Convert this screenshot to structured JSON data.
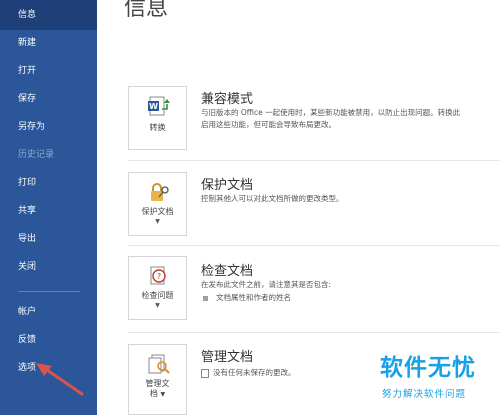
{
  "sidebar": {
    "items": [
      {
        "label": "信息"
      },
      {
        "label": "新建"
      },
      {
        "label": "打开"
      },
      {
        "label": "保存"
      },
      {
        "label": "另存为"
      },
      {
        "label": "历史记录"
      },
      {
        "label": "打印"
      },
      {
        "label": "共享"
      },
      {
        "label": "导出"
      },
      {
        "label": "关闭"
      },
      {
        "label": "帐户"
      },
      {
        "label": "反馈"
      },
      {
        "label": "选项"
      }
    ]
  },
  "main": {
    "title": "信息",
    "cards": [
      {
        "button_label": "转换",
        "title": "兼容模式",
        "desc_line1": "与旧版本的 Office 一起使用时，某些新功能被禁用，以防止出现问题。转换此",
        "desc_line2": "启用这些功能，但可能会导致布局更改。"
      },
      {
        "button_label": "保护文档",
        "title": "保护文档",
        "desc_line1": "控制其他人可以对此文档所做的更改类型。"
      },
      {
        "button_label": "检查问题",
        "title": "检查文档",
        "desc_line1": "在发布此文件之前，请注意其是否包含:",
        "bullet": "文档属性和作者的姓名"
      },
      {
        "button_label": "管理文档",
        "button_label_line1": "管理文",
        "button_label_line2": "档",
        "title": "管理文档",
        "desc_line1": "没有任何未保存的更改。"
      }
    ]
  },
  "watermark": {
    "main": "软件无忧",
    "sub": "努力解决软件问题"
  },
  "colors": {
    "sidebar": "#2b579a",
    "sidebar_active": "#1e3f78",
    "arrow": "#d9534f",
    "watermark": "#1aa0e6"
  }
}
